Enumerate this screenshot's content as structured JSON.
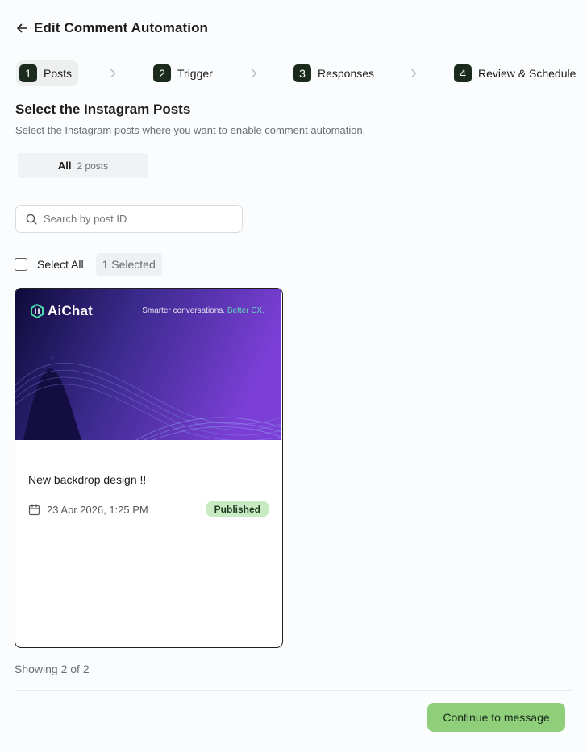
{
  "header": {
    "title": "Edit Comment Automation",
    "back_icon": "arrow-left-icon"
  },
  "steps": [
    {
      "number": "1",
      "label": "Posts",
      "active": true
    },
    {
      "number": "2",
      "label": "Trigger",
      "active": false
    },
    {
      "number": "3",
      "label": "Responses",
      "active": false
    },
    {
      "number": "4",
      "label": "Review & Schedule",
      "active": false
    }
  ],
  "section": {
    "title": "Select the Instagram Posts",
    "subtitle": "Select the Instagram posts where you want to enable comment automation."
  },
  "filter": {
    "label": "All",
    "count": "2 posts"
  },
  "search": {
    "placeholder": "Search by post ID",
    "value": ""
  },
  "selection": {
    "select_all_label": "Select All",
    "selected_badge": "1 Selected",
    "select_all_checked": false
  },
  "posts": [
    {
      "brand": "AiChat",
      "tagline_main": "Smarter conversations.",
      "tagline_highlight": "Better CX.",
      "title": "New backdrop design !!",
      "date": "23 Apr 2026, 1:25 PM",
      "status": "Published",
      "selected": true
    }
  ],
  "footer": {
    "showing": "Showing 2 of 2",
    "continue_label": "Continue to message"
  },
  "colors": {
    "accent": "#8fcf7a",
    "step_badge": "#1a2a1c",
    "status_published_bg": "#c9ebc4",
    "tagline_highlight": "#5fd9b6",
    "thumb_gradient_start": "#0f0b3a",
    "thumb_gradient_end": "#7b3fd6"
  }
}
